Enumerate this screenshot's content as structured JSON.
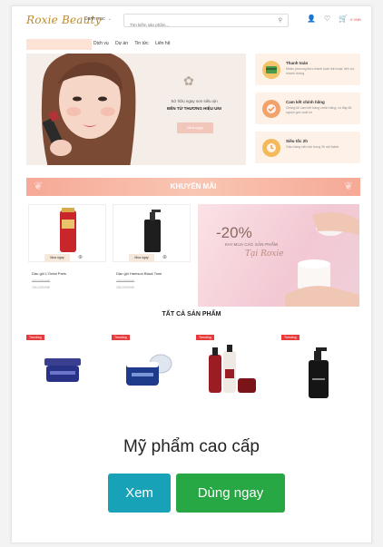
{
  "header": {
    "logo": "Roxie Beauty",
    "category_label": "Danh mục",
    "search_placeholder": "Tìm kiếm sản phẩm...",
    "cart_label": "0 VNĐ"
  },
  "nav": {
    "links": [
      "Dịch vụ",
      "Dự án",
      "Tin tức",
      "Liên hệ"
    ]
  },
  "hero": {
    "line1": "Sở hữu ngay son siêu xịn",
    "line2": "ĐẾN TỪ THƯƠNG HIỆU UNI",
    "button": "Mua ngay"
  },
  "benefits": [
    {
      "title": "Thanh toán",
      "desc": "Nhiều phương thức thanh toán linh hoạt, tiện lợi, nhanh chóng"
    },
    {
      "title": "Cam kết chính hãng",
      "desc": "Chúng tôi cam kết hàng chính hãng, có đầy đủ nguồn gốc xuất xứ"
    },
    {
      "title": "Siêu tốc 2h",
      "desc": "Giao hàng siêu tốc trong 2h nội thành"
    }
  ],
  "promo": {
    "title": "KHUYẾN MÃI"
  },
  "sale_products": [
    {
      "name": "Dầu gội L'Oréal Paris",
      "old_price": "200.000VNĐ",
      "new_price": "150.000VNĐ",
      "button": "Mua ngay"
    },
    {
      "name": "Dầu gội Hamson Black Tone",
      "old_price": "400.000VNĐ",
      "new_price": "280.000VNĐ",
      "button": "Mua ngay"
    }
  ],
  "sale_banner": {
    "percent": "-20%",
    "subtitle": "KHI MUA CÁC SẢN PHẨM",
    "brand": "Tại Roxie"
  },
  "all_products": {
    "title": "TẤT CẢ SẢN PHẨM",
    "badge": "Trending",
    "items": [
      "blue-cream-jar",
      "blue-jar-open",
      "shampoo-set",
      "black-pump-bottle"
    ]
  },
  "cta": {
    "title": "Mỹ phẩm cao cấp",
    "view_button": "Xem",
    "use_button": "Dùng ngay"
  },
  "colors": {
    "accent_peach": "#f6a996",
    "trending_red": "#e73b3b",
    "info_btn": "#17a2b8",
    "success_btn": "#28a745"
  }
}
